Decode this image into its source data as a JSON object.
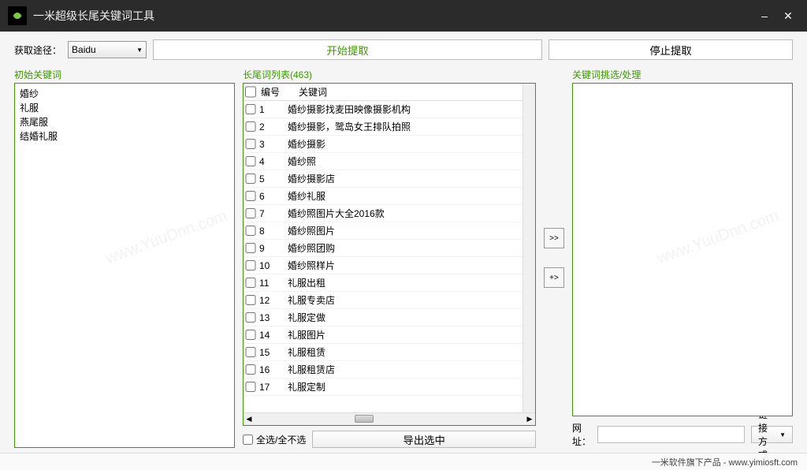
{
  "title": "一米超级长尾关键词工具",
  "toolbar": {
    "source_label": "获取途径：",
    "source_value": "Baidu",
    "start_label": "开始提取",
    "stop_label": "停止提取"
  },
  "left": {
    "title": "初始关键词",
    "items": [
      "婚纱",
      "礼服",
      "燕尾服",
      "结婚礼服"
    ]
  },
  "center": {
    "title": "长尾词列表(463)",
    "head_num": "编号",
    "head_kw": "关键词",
    "rows": [
      {
        "n": "1",
        "kw": "婚纱摄影找麦田映像摄影机构"
      },
      {
        "n": "2",
        "kw": "婚纱摄影，鹭岛女王排队拍照"
      },
      {
        "n": "3",
        "kw": "婚纱摄影"
      },
      {
        "n": "4",
        "kw": "婚纱照"
      },
      {
        "n": "5",
        "kw": "婚纱摄影店"
      },
      {
        "n": "6",
        "kw": "婚纱礼服"
      },
      {
        "n": "7",
        "kw": "婚纱照图片大全2016款"
      },
      {
        "n": "8",
        "kw": "婚纱照图片"
      },
      {
        "n": "9",
        "kw": "婚纱照团购"
      },
      {
        "n": "10",
        "kw": "婚纱照样片"
      },
      {
        "n": "11",
        "kw": "礼服出租"
      },
      {
        "n": "12",
        "kw": "礼服专卖店"
      },
      {
        "n": "13",
        "kw": "礼服定做"
      },
      {
        "n": "14",
        "kw": "礼服图片"
      },
      {
        "n": "15",
        "kw": "礼服租赁"
      },
      {
        "n": "16",
        "kw": "礼服租赁店"
      },
      {
        "n": "17",
        "kw": "礼服定制"
      }
    ],
    "selectall_label": "全选/全不选",
    "export_label": "导出选中"
  },
  "right": {
    "title": "关键词挑选/处理",
    "url_label": "网址：",
    "linkmode_label": "链接方式"
  },
  "move_all": ">>",
  "move_one": "+>",
  "status": "一米软件旗下产品 - www.yimiosft.com",
  "watermark": "www.YuuDnn.com"
}
